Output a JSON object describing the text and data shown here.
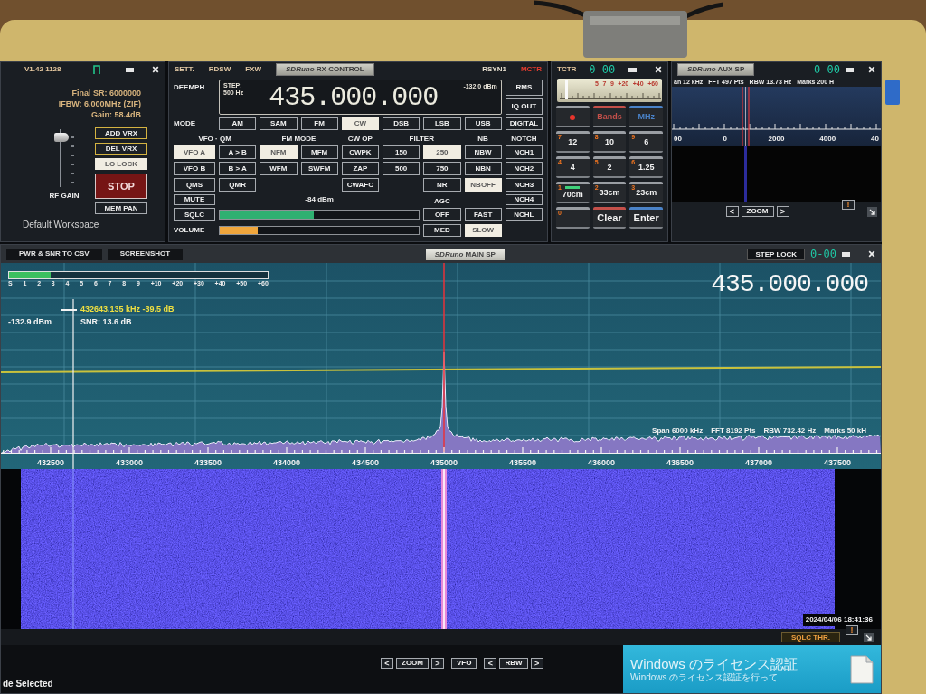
{
  "main_panel": {
    "version": "V1.42 1128",
    "info": [
      "Final SR: 6000000",
      "IFBW: 6.000MHz (ZIF)",
      "Gain: 58.4dB"
    ],
    "rf_gain": {
      "label": "RF GAIN",
      "level": 0.92
    },
    "buttons": [
      {
        "label": "ADD VRX",
        "kind": "outline",
        "on": false
      },
      {
        "label": "DEL VRX",
        "kind": "outline",
        "on": false
      },
      {
        "label": "LO LOCK",
        "kind": "plain",
        "on": true
      },
      {
        "label": "STOP",
        "kind": "stop",
        "on": false
      },
      {
        "label": "MEM PAN",
        "kind": "plain",
        "on": false
      }
    ],
    "workspace": "Default Workspace"
  },
  "rx_control": {
    "menu": [
      "SETT.",
      "RDSW",
      "FXW"
    ],
    "title": "*SDRuno* RX CONTROL",
    "flags": [
      {
        "label": "RSYN1",
        "on": false
      },
      {
        "label": "MCTR",
        "on": true
      }
    ],
    "deemph_label": "DEEMPH",
    "display": {
      "step_label": "STEP:",
      "step": "500 Hz",
      "frequency": "435.000.000",
      "power": "-132.0 dBm"
    },
    "side_buttons": [
      {
        "label": "RMS",
        "on": false
      },
      {
        "label": "IQ OUT",
        "on": false
      }
    ],
    "mode_label": "MODE",
    "modes": [
      {
        "label": "AM",
        "selected": false
      },
      {
        "label": "SAM",
        "selected": false
      },
      {
        "label": "FM",
        "selected": false
      },
      {
        "label": "CW",
        "selected": true
      },
      {
        "label": "DSB",
        "selected": false
      },
      {
        "label": "LSB",
        "selected": false
      },
      {
        "label": "USB",
        "selected": false
      },
      {
        "label": "DIGITAL",
        "selected": false
      }
    ],
    "section_labels": [
      "VFO · QM",
      "FM MODE",
      "CW OP",
      "FILTER",
      "NB",
      "NOTCH"
    ],
    "vfo": [
      {
        "label": "VFO A",
        "selected": true
      },
      {
        "label": "VFO B",
        "selected": false
      }
    ],
    "vfo_copy": [
      "A > B",
      "B > A"
    ],
    "quick_memory": [
      "QMS",
      "QMR"
    ],
    "fm_modes": [
      {
        "label": "NFM",
        "selected": true
      },
      {
        "label": "MFM",
        "selected": false
      },
      {
        "label": "WFM",
        "selected": false
      },
      {
        "label": "SWFM",
        "selected": false
      }
    ],
    "cw_op": [
      {
        "label": "CWPK",
        "on": false
      },
      {
        "label": "ZAP",
        "on": false
      },
      {
        "label": "CWAFC",
        "on": false
      }
    ],
    "filters": [
      {
        "label": "150",
        "selected": false
      },
      {
        "label": "250",
        "selected": true
      },
      {
        "label": "500",
        "selected": false
      },
      {
        "label": "750",
        "selected": false
      }
    ],
    "nr": {
      "label": "NR",
      "on": false
    },
    "nb": [
      {
        "label": "NBW",
        "selected": false
      },
      {
        "label": "NBN",
        "selected": false
      },
      {
        "label": "NBOFF",
        "selected": true
      }
    ],
    "notch": [
      {
        "label": "NCH1",
        "on": false
      },
      {
        "label": "NCH2",
        "on": false
      },
      {
        "label": "NCH3",
        "on": false
      },
      {
        "label": "NCH4",
        "on": false
      },
      {
        "label": "NCHL",
        "on": false
      }
    ],
    "mute": {
      "label": "MUTE",
      "on": false
    },
    "sqlc": {
      "label": "SQLC",
      "on": false
    },
    "signal": {
      "reading": "-84 dBm",
      "level": 0.47
    },
    "volume": {
      "label": "VOLUME",
      "level": 0.19
    },
    "agc_label": "AGC",
    "agc": [
      {
        "label": "OFF",
        "selected": false
      },
      {
        "label": "FAST",
        "selected": false
      },
      {
        "label": "MED",
        "selected": false
      },
      {
        "label": "SLOW",
        "selected": true
      }
    ]
  },
  "keypad": {
    "title": "TCTR",
    "display": "0-00",
    "meter": {
      "scale": [
        "5",
        "7",
        "9",
        "+20",
        "+40",
        "+60"
      ],
      "level": 0.08
    },
    "keys": [
      {
        "kind": "dot",
        "color": "#9a9ea3",
        "selected": false
      },
      {
        "kind": "menu",
        "label": "Bands",
        "color": "#c4504a",
        "selected": false
      },
      {
        "kind": "menu",
        "label": "MHz",
        "color": "#4a82c8",
        "selected": false
      },
      {
        "kind": "band",
        "digit": "7",
        "label": "12",
        "color": "#9a9ea3",
        "selected": false
      },
      {
        "kind": "band",
        "digit": "8",
        "label": "10",
        "color": "#9a9ea3",
        "selected": false
      },
      {
        "kind": "band",
        "digit": "9",
        "label": "6",
        "color": "#9a9ea3",
        "selected": false
      },
      {
        "kind": "band",
        "digit": "4",
        "label": "4",
        "color": "#9a9ea3",
        "selected": false
      },
      {
        "kind": "band",
        "digit": "5",
        "label": "2",
        "color": "#9a9ea3",
        "selected": false
      },
      {
        "kind": "band",
        "digit": "6",
        "label": "1.25",
        "color": "#9a9ea3",
        "selected": false
      },
      {
        "kind": "band",
        "digit": "1",
        "label": "70cm",
        "color": "#9a9ea3",
        "selected": true
      },
      {
        "kind": "band",
        "digit": "2",
        "label": "33cm",
        "color": "#9a9ea3",
        "selected": false
      },
      {
        "kind": "band",
        "digit": "3",
        "label": "23cm",
        "color": "#9a9ea3",
        "selected": false
      },
      {
        "kind": "blank",
        "digit": "0",
        "color": "#9a9ea3",
        "selected": false
      },
      {
        "kind": "action",
        "label": "Clear",
        "color": "#c4504a",
        "selected": false
      },
      {
        "kind": "action",
        "label": "Enter",
        "color": "#4a82c8",
        "selected": false
      }
    ]
  },
  "aux_sp": {
    "title": "*SDRuno* AUX SP",
    "display": "0-00",
    "info": [
      "an 12 kHz",
      "FFT 497 Pts",
      "RBW 13.73 Hz",
      "Marks 200 H"
    ],
    "scale_labels": [
      "00",
      "0",
      "2000",
      "4000",
      "40"
    ],
    "zoom": {
      "prev": "<",
      "label": "ZOOM",
      "next": ">"
    },
    "alert": "!"
  },
  "main_sp": {
    "tools": [
      "PWR & SNR TO CSV",
      "SCREENSHOT"
    ],
    "title": "*SDRuno* MAIN SP",
    "step_lock": "STEP LOCK",
    "display": "0-00",
    "s_meter": {
      "level": 0.16,
      "scale": [
        "S",
        "1",
        "2",
        "3",
        "4",
        "5",
        "6",
        "7",
        "8",
        "9",
        "+10",
        "+20",
        "+30",
        "+40",
        "+50",
        "+60"
      ]
    },
    "cursor": {
      "readout": "432643.135 kHz -39.5 dB",
      "power": "-132.9 dBm",
      "snr": "SNR: 13.6 dB"
    },
    "frequency": "435.000.000",
    "info": [
      "Span 6000 kHz",
      "FFT 8192 Pts",
      "RBW 732.42 Hz",
      "Marks 50 kH"
    ],
    "axis_labels": [
      "432500",
      "433000",
      "433500",
      "434000",
      "434500",
      "435000",
      "435500",
      "436000",
      "436500",
      "437000",
      "437500"
    ],
    "timestamp": "2024/04/06 18:41:36",
    "sqlc_thr": "SQLC THR.",
    "alert": "!",
    "status": "de Selected",
    "bottom_controls": [
      {
        "kind": "stepper",
        "prev": "<",
        "label": "ZOOM",
        "next": ">"
      },
      {
        "kind": "button",
        "label": "VFO"
      },
      {
        "kind": "stepper",
        "prev": "<",
        "label": "RBW",
        "next": ">"
      }
    ]
  },
  "desktop": {
    "notice_title": "Windows のライセンス認証",
    "notice_text": "Windows のライセンス認証を行って"
  }
}
